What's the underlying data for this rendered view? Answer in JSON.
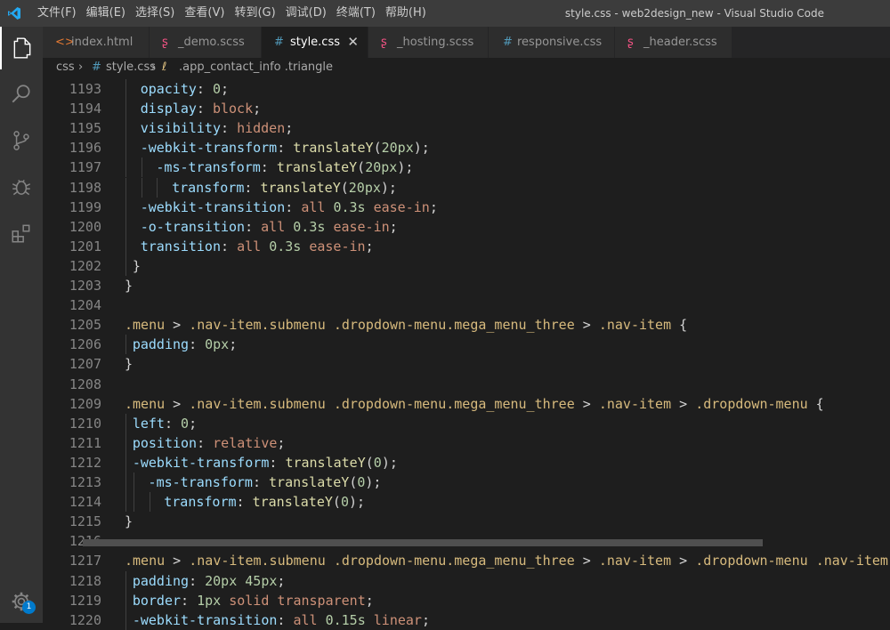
{
  "titlebar": {
    "menus": [
      "文件(F)",
      "编辑(E)",
      "选择(S)",
      "查看(V)",
      "转到(G)",
      "调试(D)",
      "终端(T)",
      "帮助(H)"
    ],
    "window_title": "style.css - web2design_new - Visual Studio Code"
  },
  "activity_bar": {
    "icons": [
      "files-icon",
      "search-icon",
      "source-control-icon",
      "debug-icon",
      "extensions-icon",
      "settings-gear-icon"
    ],
    "badge": "1"
  },
  "tabs": [
    {
      "label": "index.html",
      "icon": "html-file-icon",
      "active": false
    },
    {
      "label": "_demo.scss",
      "icon": "sass-file-icon",
      "active": false
    },
    {
      "label": "style.css",
      "icon": "css-file-icon",
      "active": true
    },
    {
      "label": "_hosting.scss",
      "icon": "sass-file-icon",
      "active": false
    },
    {
      "label": "responsive.css",
      "icon": "css-file-icon",
      "active": false
    },
    {
      "label": "_header.scss",
      "icon": "sass-file-icon",
      "active": false
    }
  ],
  "breadcrumb": [
    "css",
    "style.css",
    ".app_contact_info .triangle"
  ],
  "editor": {
    "lines": [
      {
        "n": "1193",
        "indent": 2,
        "tokens": [
          [
            "prop",
            "opacity"
          ],
          [
            "punc",
            ": "
          ],
          [
            "num",
            "0"
          ],
          [
            "punc",
            ";"
          ]
        ]
      },
      {
        "n": "1194",
        "indent": 2,
        "tokens": [
          [
            "prop",
            "display"
          ],
          [
            "punc",
            ": "
          ],
          [
            "val",
            "block"
          ],
          [
            "punc",
            ";"
          ]
        ]
      },
      {
        "n": "1195",
        "indent": 2,
        "tokens": [
          [
            "prop",
            "visibility"
          ],
          [
            "punc",
            ": "
          ],
          [
            "val",
            "hidden"
          ],
          [
            "punc",
            ";"
          ]
        ]
      },
      {
        "n": "1196",
        "indent": 2,
        "tokens": [
          [
            "prop",
            "-webkit-transform"
          ],
          [
            "punc",
            ": "
          ],
          [
            "fn",
            "translateY"
          ],
          [
            "punc",
            "("
          ],
          [
            "num",
            "20px"
          ],
          [
            "punc",
            ");"
          ]
        ]
      },
      {
        "n": "1197",
        "indent": 4,
        "tokens": [
          [
            "prop",
            "-ms-transform"
          ],
          [
            "punc",
            ": "
          ],
          [
            "fn",
            "translateY"
          ],
          [
            "punc",
            "("
          ],
          [
            "num",
            "20px"
          ],
          [
            "punc",
            ");"
          ]
        ]
      },
      {
        "n": "1198",
        "indent": 6,
        "tokens": [
          [
            "prop",
            "transform"
          ],
          [
            "punc",
            ": "
          ],
          [
            "fn",
            "translateY"
          ],
          [
            "punc",
            "("
          ],
          [
            "num",
            "20px"
          ],
          [
            "punc",
            ");"
          ]
        ]
      },
      {
        "n": "1199",
        "indent": 2,
        "tokens": [
          [
            "prop",
            "-webkit-transition"
          ],
          [
            "punc",
            ": "
          ],
          [
            "val",
            "all"
          ],
          [
            "punc",
            " "
          ],
          [
            "num",
            "0.3s"
          ],
          [
            "punc",
            " "
          ],
          [
            "val",
            "ease-in"
          ],
          [
            "punc",
            ";"
          ]
        ]
      },
      {
        "n": "1200",
        "indent": 2,
        "tokens": [
          [
            "prop",
            "-o-transition"
          ],
          [
            "punc",
            ": "
          ],
          [
            "val",
            "all"
          ],
          [
            "punc",
            " "
          ],
          [
            "num",
            "0.3s"
          ],
          [
            "punc",
            " "
          ],
          [
            "val",
            "ease-in"
          ],
          [
            "punc",
            ";"
          ]
        ]
      },
      {
        "n": "1201",
        "indent": 2,
        "tokens": [
          [
            "prop",
            "transition"
          ],
          [
            "punc",
            ": "
          ],
          [
            "val",
            "all"
          ],
          [
            "punc",
            " "
          ],
          [
            "num",
            "0.3s"
          ],
          [
            "punc",
            " "
          ],
          [
            "val",
            "ease-in"
          ],
          [
            "punc",
            ";"
          ]
        ]
      },
      {
        "n": "1202",
        "indent": 1,
        "tokens": [
          [
            "punc",
            "}"
          ]
        ]
      },
      {
        "n": "1203",
        "indent": 0,
        "tokens": [
          [
            "punc",
            "}"
          ]
        ]
      },
      {
        "n": "1204",
        "indent": 0,
        "tokens": []
      },
      {
        "n": "1205",
        "indent": 0,
        "tokens": [
          [
            "sel",
            ".menu"
          ],
          [
            "punc",
            " > "
          ],
          [
            "sel",
            ".nav-item.submenu"
          ],
          [
            "punc",
            " "
          ],
          [
            "sel",
            ".dropdown-menu.mega_menu_three"
          ],
          [
            "punc",
            " > "
          ],
          [
            "sel",
            ".nav-item"
          ],
          [
            "punc",
            " {"
          ]
        ]
      },
      {
        "n": "1206",
        "indent": 1,
        "tokens": [
          [
            "prop",
            "padding"
          ],
          [
            "punc",
            ": "
          ],
          [
            "num",
            "0px"
          ],
          [
            "punc",
            ";"
          ]
        ]
      },
      {
        "n": "1207",
        "indent": 0,
        "tokens": [
          [
            "punc",
            "}"
          ]
        ]
      },
      {
        "n": "1208",
        "indent": 0,
        "tokens": []
      },
      {
        "n": "1209",
        "indent": 0,
        "tokens": [
          [
            "sel",
            ".menu"
          ],
          [
            "punc",
            " > "
          ],
          [
            "sel",
            ".nav-item.submenu"
          ],
          [
            "punc",
            " "
          ],
          [
            "sel",
            ".dropdown-menu.mega_menu_three"
          ],
          [
            "punc",
            " > "
          ],
          [
            "sel",
            ".nav-item"
          ],
          [
            "punc",
            " > "
          ],
          [
            "sel",
            ".dropdown-menu"
          ],
          [
            "punc",
            " {"
          ]
        ]
      },
      {
        "n": "1210",
        "indent": 1,
        "tokens": [
          [
            "prop",
            "left"
          ],
          [
            "punc",
            ": "
          ],
          [
            "num",
            "0"
          ],
          [
            "punc",
            ";"
          ]
        ]
      },
      {
        "n": "1211",
        "indent": 1,
        "tokens": [
          [
            "prop",
            "position"
          ],
          [
            "punc",
            ": "
          ],
          [
            "val",
            "relative"
          ],
          [
            "punc",
            ";"
          ]
        ]
      },
      {
        "n": "1212",
        "indent": 1,
        "tokens": [
          [
            "prop",
            "-webkit-transform"
          ],
          [
            "punc",
            ": "
          ],
          [
            "fn",
            "translateY"
          ],
          [
            "punc",
            "("
          ],
          [
            "num",
            "0"
          ],
          [
            "punc",
            ");"
          ]
        ]
      },
      {
        "n": "1213",
        "indent": 3,
        "tokens": [
          [
            "prop",
            "-ms-transform"
          ],
          [
            "punc",
            ": "
          ],
          [
            "fn",
            "translateY"
          ],
          [
            "punc",
            "("
          ],
          [
            "num",
            "0"
          ],
          [
            "punc",
            ");"
          ]
        ]
      },
      {
        "n": "1214",
        "indent": 5,
        "tokens": [
          [
            "prop",
            "transform"
          ],
          [
            "punc",
            ": "
          ],
          [
            "fn",
            "translateY"
          ],
          [
            "punc",
            "("
          ],
          [
            "num",
            "0"
          ],
          [
            "punc",
            ");"
          ]
        ]
      },
      {
        "n": "1215",
        "indent": 0,
        "tokens": [
          [
            "punc",
            "}"
          ]
        ]
      },
      {
        "n": "1216",
        "indent": 0,
        "tokens": []
      },
      {
        "n": "1217",
        "indent": 0,
        "tokens": [
          [
            "sel",
            ".menu"
          ],
          [
            "punc",
            " > "
          ],
          [
            "sel",
            ".nav-item.submenu"
          ],
          [
            "punc",
            " "
          ],
          [
            "sel",
            ".dropdown-menu.mega_menu_three"
          ],
          [
            "punc",
            " > "
          ],
          [
            "sel",
            ".nav-item"
          ],
          [
            "punc",
            " > "
          ],
          [
            "sel",
            ".dropdown-menu"
          ],
          [
            "punc",
            " "
          ],
          [
            "sel",
            ".nav-item"
          ],
          [
            "punc",
            " {"
          ]
        ]
      },
      {
        "n": "1218",
        "indent": 1,
        "tokens": [
          [
            "prop",
            "padding"
          ],
          [
            "punc",
            ": "
          ],
          [
            "num",
            "20px 45px"
          ],
          [
            "punc",
            ";"
          ]
        ]
      },
      {
        "n": "1219",
        "indent": 1,
        "tokens": [
          [
            "prop",
            "border"
          ],
          [
            "punc",
            ": "
          ],
          [
            "num",
            "1px"
          ],
          [
            "punc",
            " "
          ],
          [
            "val",
            "solid transparent"
          ],
          [
            "punc",
            ";"
          ]
        ]
      },
      {
        "n": "1220",
        "indent": 1,
        "tokens": [
          [
            "prop",
            "-webkit-transition"
          ],
          [
            "punc",
            ": "
          ],
          [
            "val",
            "all"
          ],
          [
            "punc",
            " "
          ],
          [
            "num",
            "0.15s"
          ],
          [
            "punc",
            " "
          ],
          [
            "val",
            "linear"
          ],
          [
            "punc",
            ";"
          ]
        ]
      }
    ]
  },
  "colors": {
    "selector": "#d7ba7d",
    "property": "#9cdcfe",
    "number": "#b5cea8",
    "value": "#ce9178",
    "function": "#dcdcaa",
    "accent": "#007acc"
  }
}
